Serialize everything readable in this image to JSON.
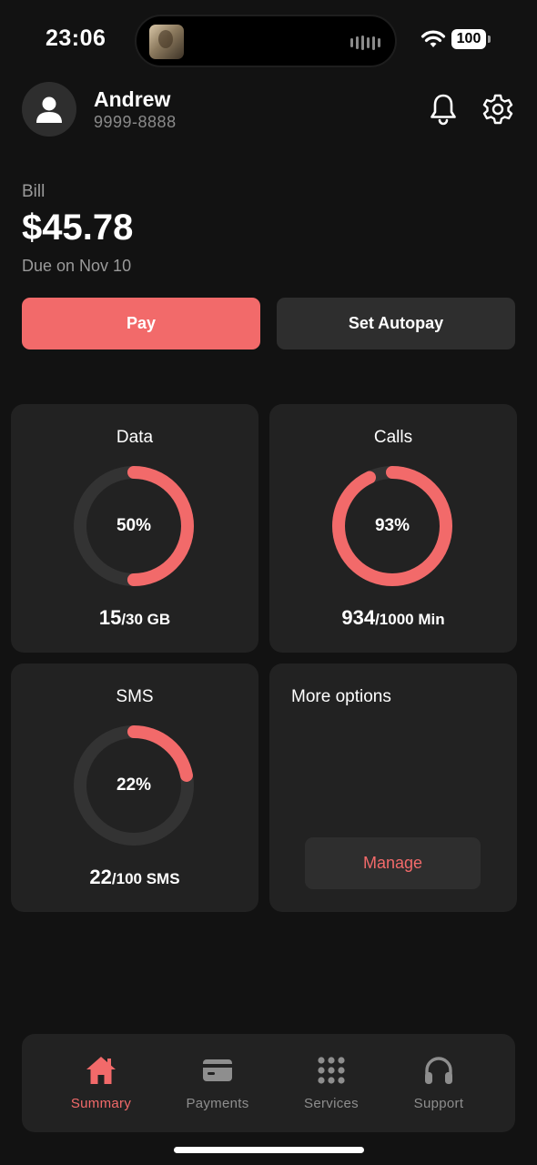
{
  "status_bar": {
    "time": "23:06",
    "battery": "100",
    "icons": [
      "now-playing-thumbnail-icon",
      "audio-waveform-icon",
      "wifi-icon",
      "battery-icon"
    ]
  },
  "header": {
    "user_name": "Andrew",
    "phone": "9999-8888",
    "icons": [
      "avatar-person-icon",
      "bell-icon",
      "gear-icon"
    ]
  },
  "bill": {
    "label": "Bill",
    "amount": "$45.78",
    "due": "Due on Nov 10",
    "pay_label": "Pay",
    "autopay_label": "Set Autopay"
  },
  "usage_cards": [
    {
      "title": "Data",
      "percent": 50,
      "percent_label": "50%",
      "used": "15",
      "total": "/30 GB"
    },
    {
      "title": "Calls",
      "percent": 93,
      "percent_label": "93%",
      "used": "934",
      "total": "/1000 Min"
    },
    {
      "title": "SMS",
      "percent": 22,
      "percent_label": "22%",
      "used": "22",
      "total": "/100 SMS"
    }
  ],
  "more_options": {
    "title": "More options",
    "manage_label": "Manage"
  },
  "bottom_nav": {
    "items": [
      {
        "label": "Summary",
        "icon": "home-icon",
        "active": true
      },
      {
        "label": "Payments",
        "icon": "card-icon",
        "active": false
      },
      {
        "label": "Services",
        "icon": "grid-icon",
        "active": false
      },
      {
        "label": "Support",
        "icon": "headphones-icon",
        "active": false
      }
    ]
  },
  "colors": {
    "background": "#121212",
    "card": "#222222",
    "accent": "#f26a6a",
    "ring_track": "#333333",
    "muted_text": "#8a8a8a"
  }
}
